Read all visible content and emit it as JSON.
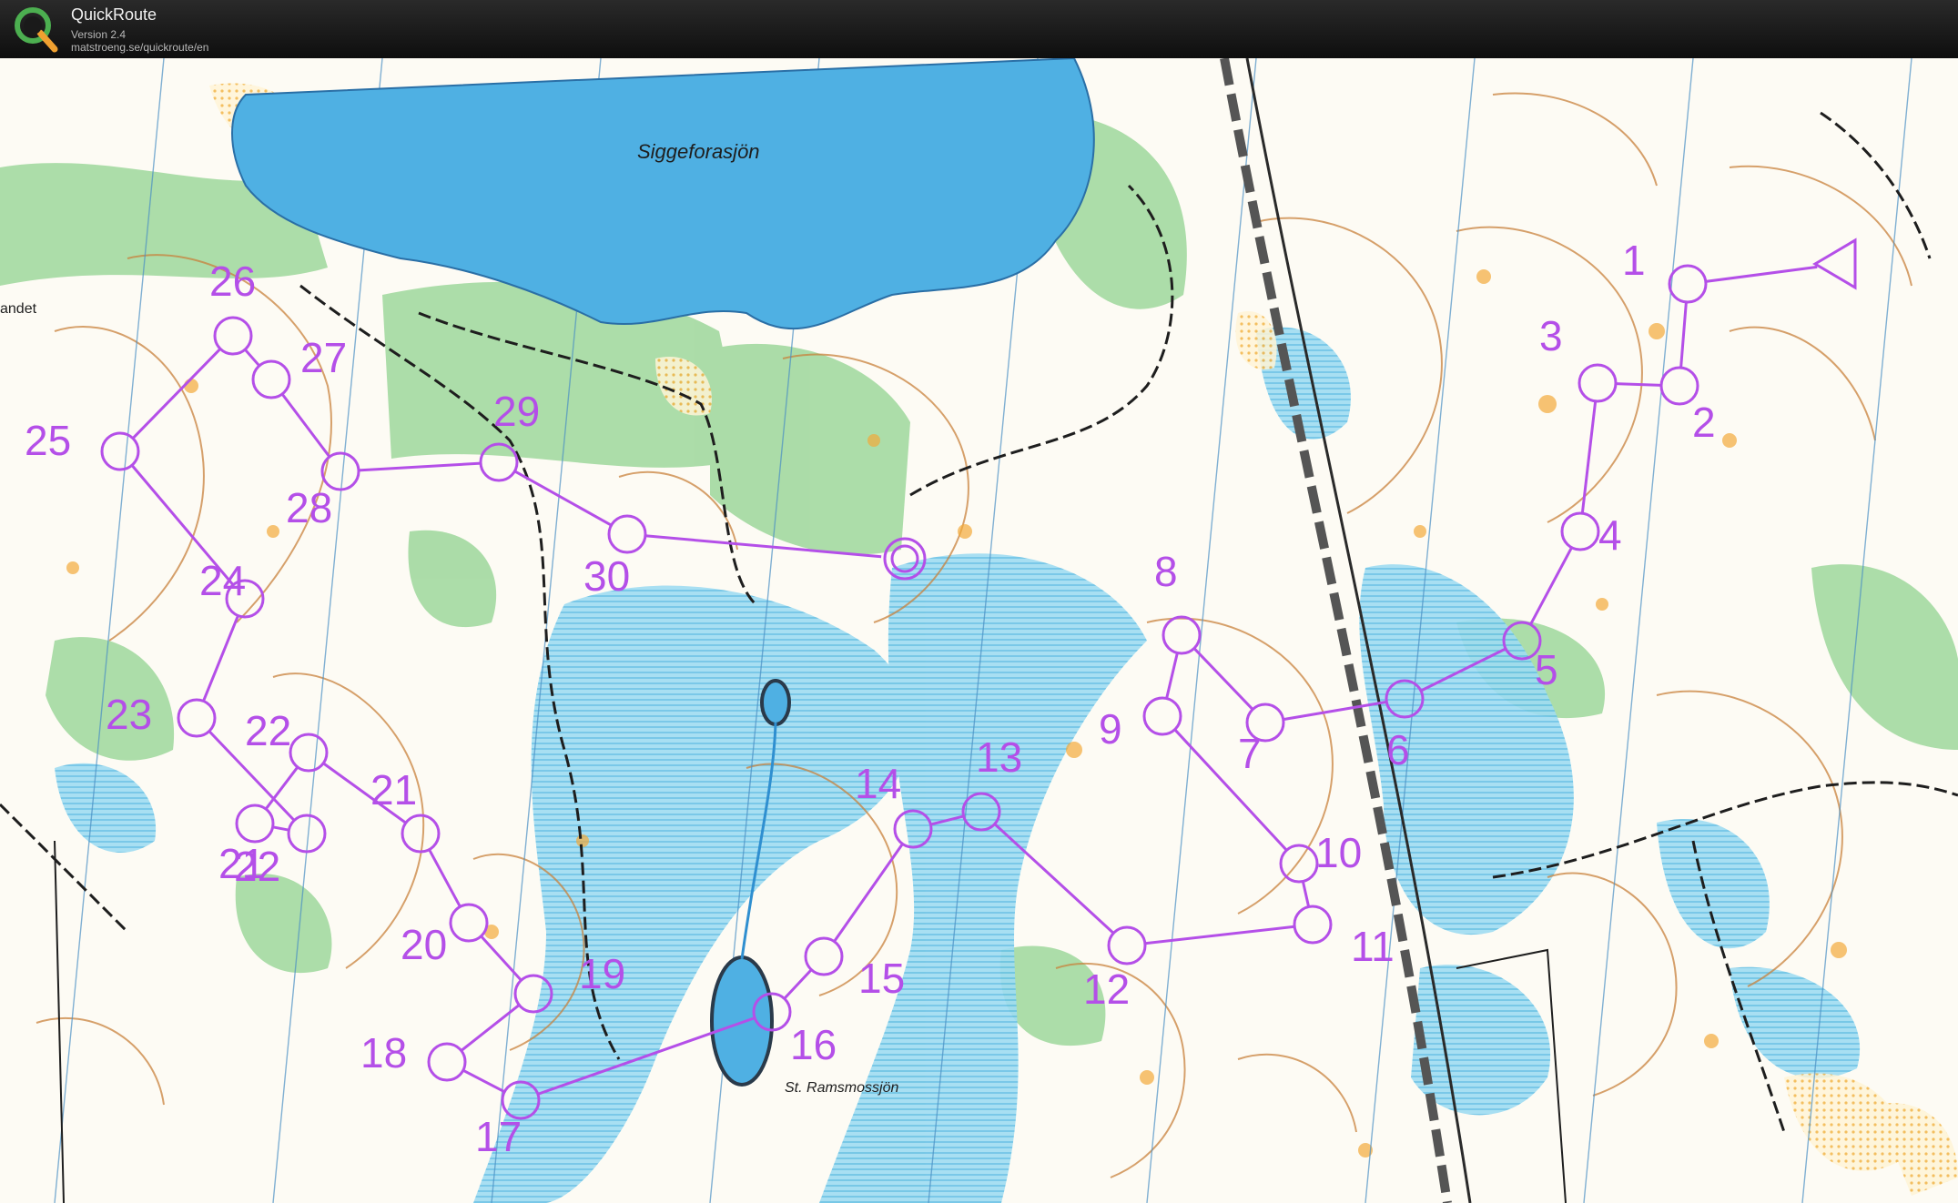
{
  "app": {
    "title": "QuickRoute",
    "version": "Version 2.4",
    "url": "matstroeng.se/quickroute/en",
    "logo_letter": "Q"
  },
  "map": {
    "labels": {
      "lake_north": "Siggeforasjön",
      "lake_south": "St. Ramsmossjön",
      "place_west": "andet"
    },
    "course_color": "#b44fe8",
    "lake_color": "#4fb0e3",
    "marsh_color": "#7fd3ef",
    "forest_color": "#88cf8a",
    "contour_color": "#c8813c"
  },
  "course": {
    "start_label": "Start",
    "controls": [
      {
        "number": "1"
      },
      {
        "number": "2"
      },
      {
        "number": "3"
      },
      {
        "number": "4"
      },
      {
        "number": "5"
      },
      {
        "number": "6"
      },
      {
        "number": "7"
      },
      {
        "number": "8"
      },
      {
        "number": "9"
      },
      {
        "number": "10"
      },
      {
        "number": "11"
      },
      {
        "number": "12"
      },
      {
        "number": "13"
      },
      {
        "number": "14"
      },
      {
        "number": "15"
      },
      {
        "number": "16"
      },
      {
        "number": "17"
      },
      {
        "number": "18"
      },
      {
        "number": "19"
      },
      {
        "number": "20"
      },
      {
        "number": "21"
      },
      {
        "number": "22"
      },
      {
        "number": "21"
      },
      {
        "number": "22"
      },
      {
        "number": "23"
      },
      {
        "number": "24"
      },
      {
        "number": "25"
      },
      {
        "number": "26"
      },
      {
        "number": "27"
      },
      {
        "number": "28"
      },
      {
        "number": "29"
      },
      {
        "number": "30"
      }
    ],
    "finish_label": "Finish"
  }
}
